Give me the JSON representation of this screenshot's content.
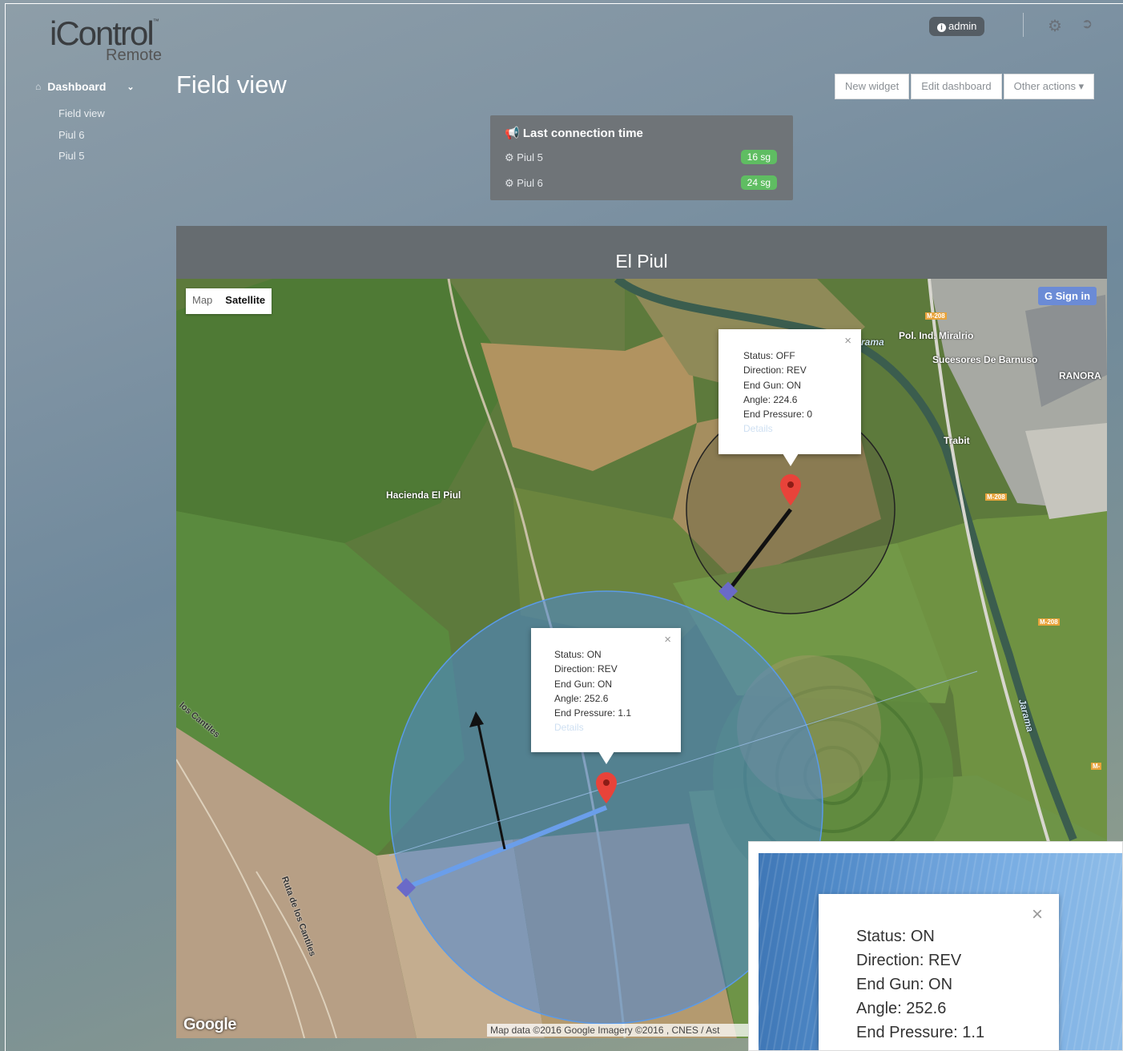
{
  "app": {
    "logo_main": "iControl",
    "logo_tm": "™",
    "logo_sub": "Remote"
  },
  "topbar": {
    "user": "admin",
    "user_icon": "info-circle-icon",
    "settings_icon": "gear-icon",
    "logout_icon": "sign-out-icon"
  },
  "sidebar": {
    "dashboard_label": "Dashboard",
    "items": [
      {
        "label": "Field view"
      },
      {
        "label": "Piul 6"
      },
      {
        "label": "Piul 5"
      }
    ]
  },
  "page": {
    "title": "Field view"
  },
  "toolbar": {
    "new_widget": "New widget",
    "edit_dashboard": "Edit dashboard",
    "other_actions": "Other actions ▾"
  },
  "connection": {
    "title": "Last connection time",
    "rows": [
      {
        "name": "Piul 5",
        "time": "16 sg"
      },
      {
        "name": "Piul 6",
        "time": "24 sg"
      }
    ],
    "badge_color": "#5fbd62"
  },
  "widget": {
    "title": "El Piul"
  },
  "map": {
    "map_label": "Map",
    "satellite_label": "Satellite",
    "sign_in": "G Sign in",
    "google": "Google",
    "attribution": "Map data ©2016 Google Imagery ©2016 , CNES / Ast",
    "places": {
      "hacienda": "Hacienda El Piul",
      "pol_ind": "Pol. Ind. Miralrio",
      "sucesores": "Sucesores De Barnuso",
      "ranora": "RANORA",
      "trabit": "Trabit",
      "jarama": "Jarama",
      "jarama_top": "rama",
      "ruta": "Ruta de los Cantiles",
      "cantiles": "los Cantiles",
      "m208": "M-208",
      "m2": "M-"
    },
    "popup_off": {
      "status": "Status: OFF",
      "direction": "Direction: REV",
      "end_gun": "End Gun: ON",
      "angle": "Angle: 224.6",
      "end_pressure": "End Pressure: 0",
      "details": "Details"
    },
    "popup_on": {
      "status": "Status: ON",
      "direction": "Direction: REV",
      "end_gun": "End Gun: ON",
      "angle": "Angle: 252.6",
      "end_pressure": "End Pressure: 1.1",
      "details": "Details"
    }
  },
  "inset": {
    "status": "Status: ON",
    "direction": "Direction: REV",
    "end_gun": "End Gun: ON",
    "angle": "Angle: 252.6",
    "end_pressure": "End Pressure: 1.1"
  }
}
